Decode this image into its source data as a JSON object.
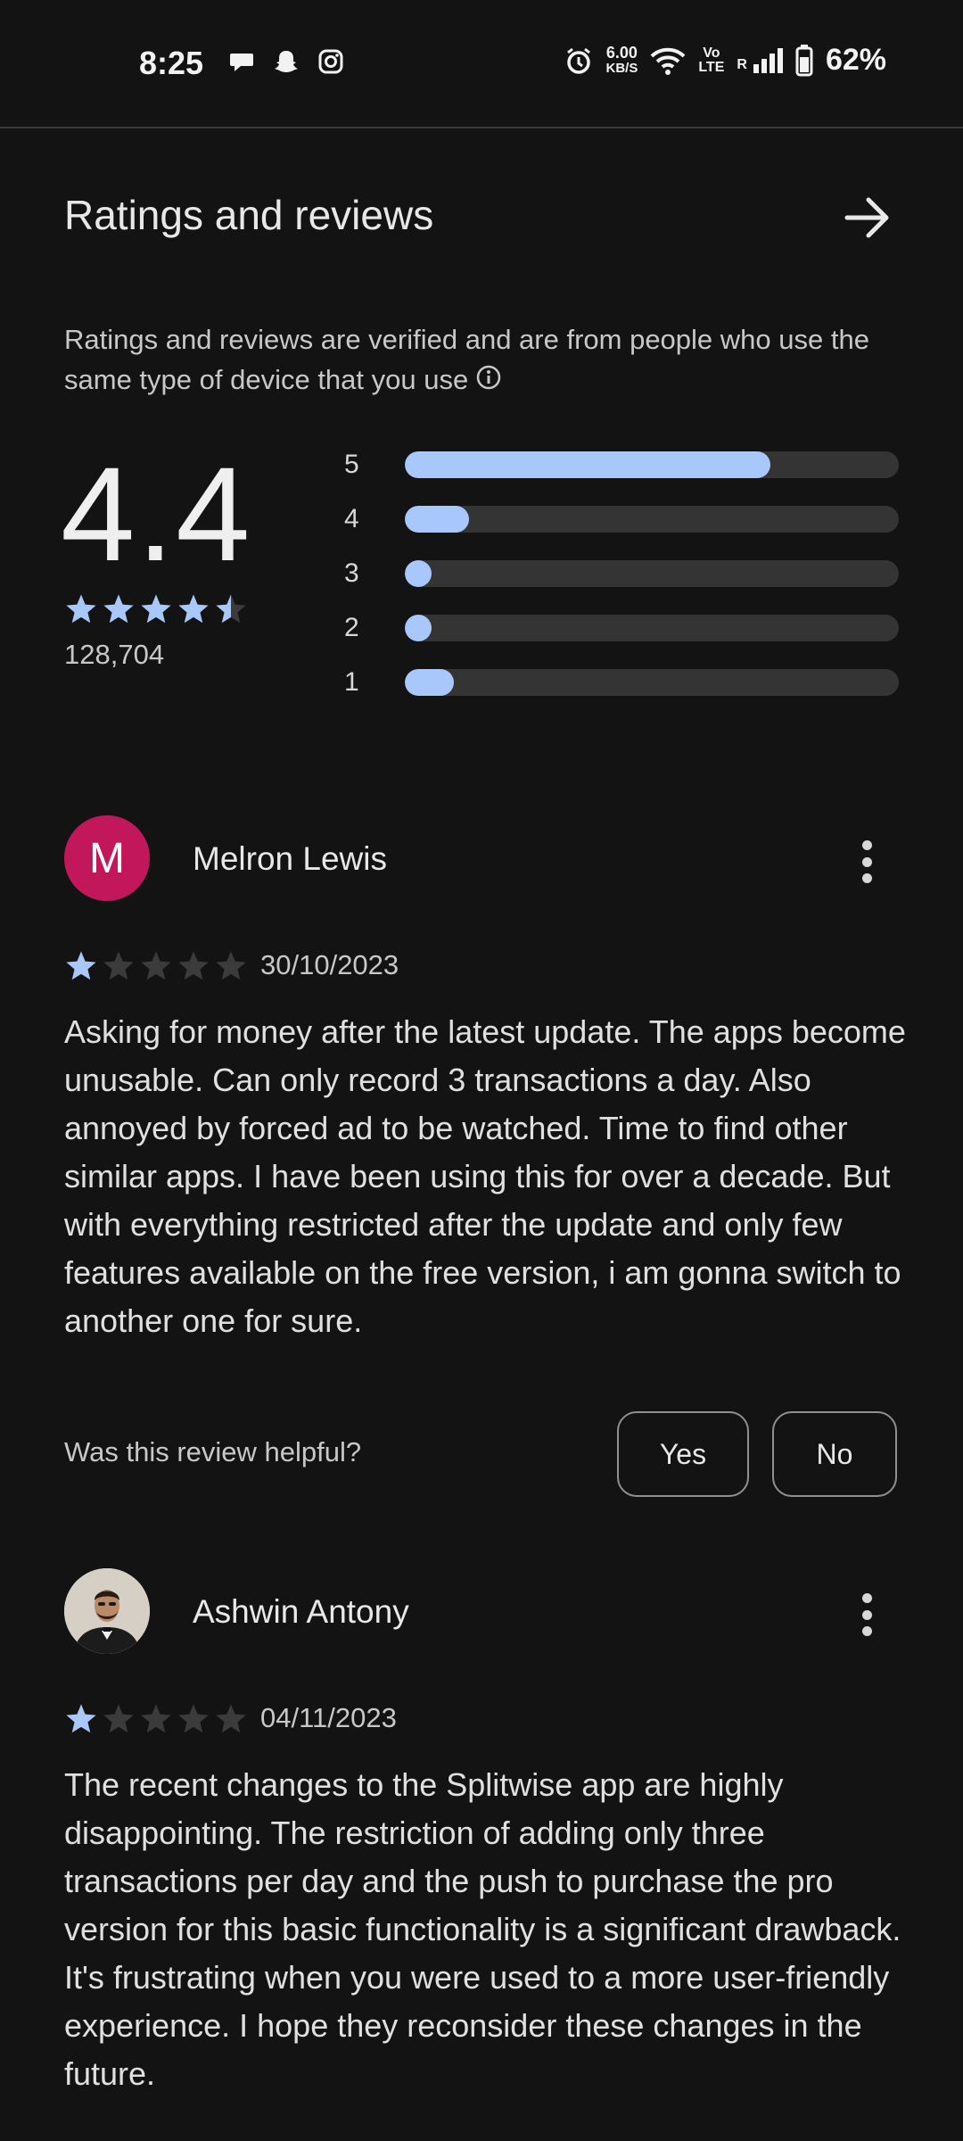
{
  "status_bar": {
    "time": "8:25",
    "speed_value": "6.00",
    "speed_unit": "KB/S",
    "volte_top": "Vo",
    "volte_bottom": "LTE",
    "roaming": "R",
    "battery": "62%",
    "notification_icons": [
      "chat-bubble-icon",
      "snapchat-icon",
      "instagram-icon"
    ]
  },
  "header": {
    "title": "Ratings and reviews",
    "arrow_icon": "arrow-right-icon"
  },
  "verification": {
    "text": "Ratings and reviews are verified and are from people who use the same type of device that you use"
  },
  "summary": {
    "score": "4.4",
    "stars": 4.5,
    "count": "128,704",
    "distribution": [
      {
        "label": "5",
        "fraction": 0.74
      },
      {
        "label": "4",
        "fraction": 0.13
      },
      {
        "label": "3",
        "fraction": 0.05
      },
      {
        "label": "2",
        "fraction": 0.05
      },
      {
        "label": "1",
        "fraction": 0.1
      }
    ]
  },
  "colors": {
    "accent": "#a8c7fa",
    "star_empty": "#3b3b3b",
    "avatar_m": "#c2185b",
    "background": "#131313"
  },
  "reviews": [
    {
      "avatar_letter": "M",
      "name": "Melron Lewis",
      "rating": 1,
      "date": "30/10/2023",
      "body": "Asking for money after the latest update. The apps become unusable. Can only record 3 transactions a day. Also annoyed by forced ad to be watched. Time to find other similar apps. I have been using this for over a decade. But with everything restricted after the update and only few features available on the free version, i am gonna switch to another one for sure.",
      "helpful_question": "Was this review helpful?",
      "yes_label": "Yes",
      "no_label": "No"
    },
    {
      "name": "Ashwin Antony",
      "rating": 1,
      "date": "04/11/2023",
      "body": "The recent changes to the Splitwise app are highly disappointing. The restriction of adding only three transactions per day and the push to purchase the pro version for this basic functionality is a significant drawback. It's frustrating when you were used to a more user-friendly experience. I hope they reconsider these changes in the future."
    }
  ]
}
